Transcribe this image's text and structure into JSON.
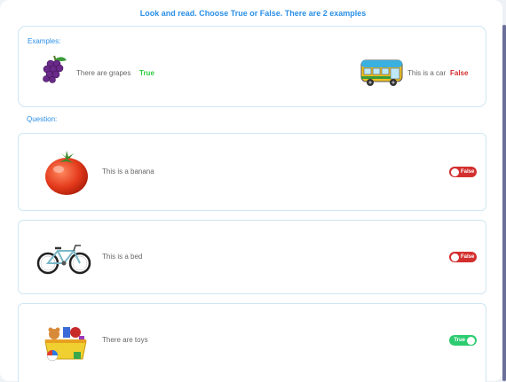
{
  "header": {
    "title": "Look and read. Choose True or False. There are 2 examples"
  },
  "examples": {
    "label": "Examples:",
    "items": [
      {
        "text": "There are grapes",
        "answer": "True",
        "answer_color": "#2ecc40",
        "icon": "grapes-icon"
      },
      {
        "text": "This is a car",
        "answer": "False",
        "answer_color": "#d32f2f",
        "icon": "bus-icon"
      }
    ]
  },
  "question_label": "Question:",
  "questions": [
    {
      "text": "This is a banana",
      "toggle": "False",
      "state": "off",
      "icon": "tomato-icon"
    },
    {
      "text": "This is a bed",
      "toggle": "False",
      "state": "off",
      "icon": "bicycle-icon"
    },
    {
      "text": "There are toys",
      "toggle": "True",
      "state": "on",
      "icon": "toy-box-icon"
    }
  ],
  "colors": {
    "accent": "#2a8fe6",
    "true": "#2ecc71",
    "false": "#d32f2f",
    "border": "#cfe6f2"
  }
}
